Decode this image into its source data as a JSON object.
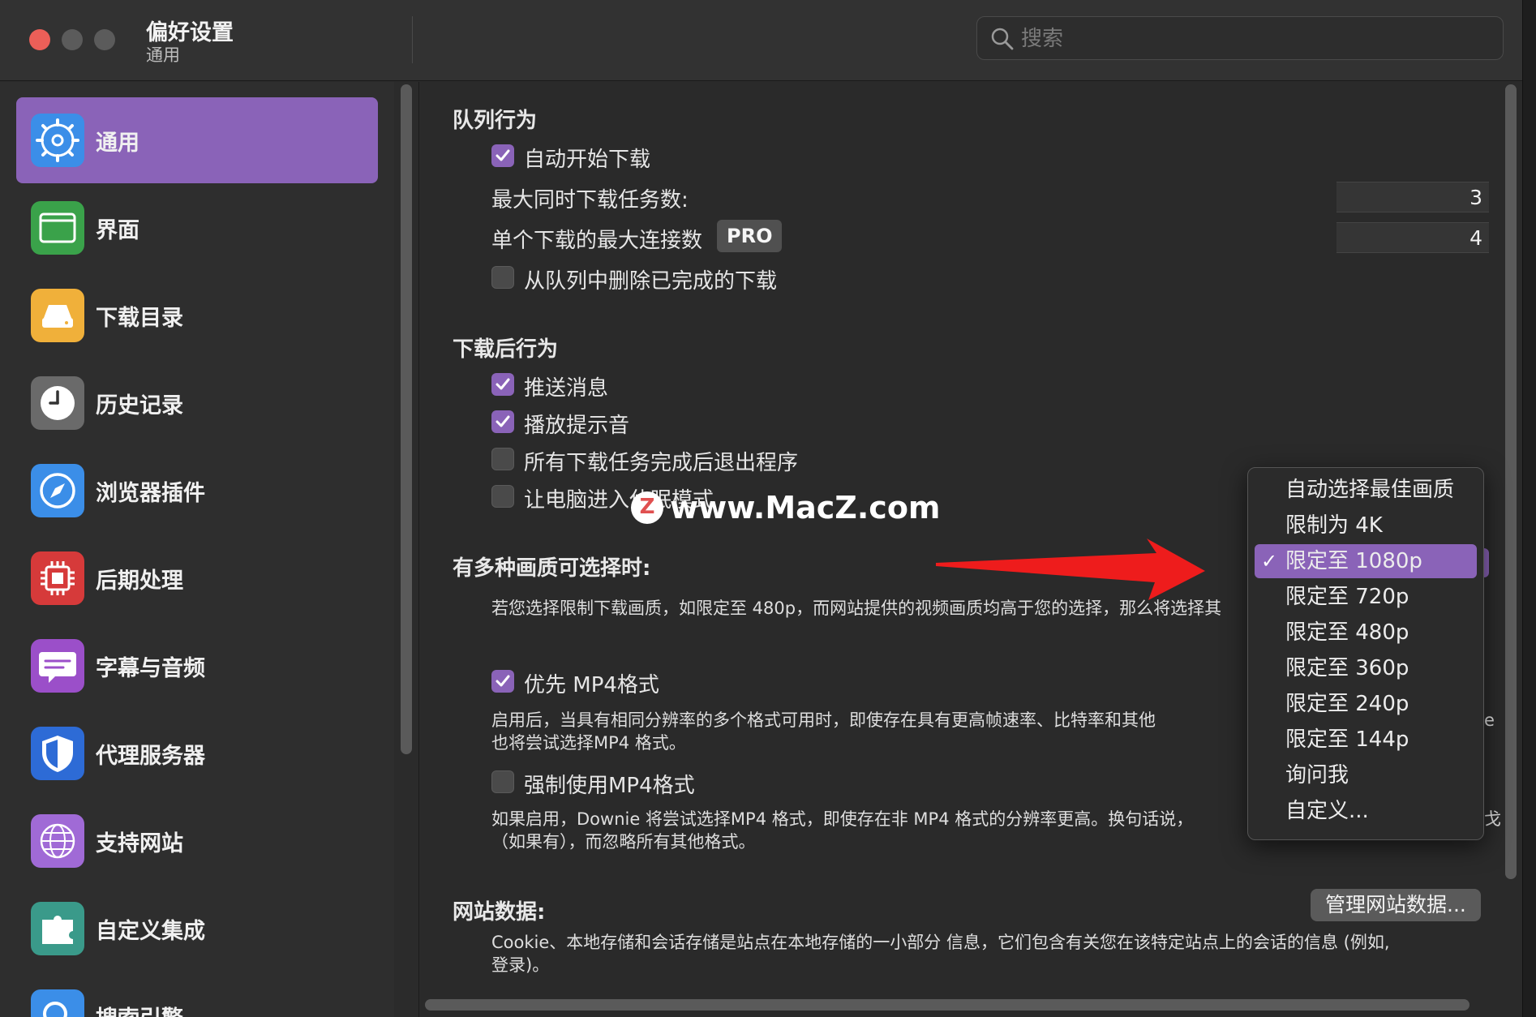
{
  "window": {
    "title": "偏好设置",
    "subtitle": "通用",
    "search_placeholder": "搜索"
  },
  "sidebar": {
    "items": [
      {
        "label": "通用",
        "icon": "gear-icon",
        "color": "#3b8ee8",
        "active": true
      },
      {
        "label": "界面",
        "icon": "window-icon",
        "color": "#3aa24a"
      },
      {
        "label": "下载目录",
        "icon": "drive-icon",
        "color": "#f0b03a"
      },
      {
        "label": "历史记录",
        "icon": "clock-icon",
        "color": "#6a6a6a"
      },
      {
        "label": "浏览器插件",
        "icon": "compass-icon",
        "color": "#3b8ee8"
      },
      {
        "label": "后期处理",
        "icon": "chip-icon",
        "color": "#d63a3a"
      },
      {
        "label": "字幕与音频",
        "icon": "caption-icon",
        "color": "#9b4fc9"
      },
      {
        "label": "代理服务器",
        "icon": "shield-icon",
        "color": "#2d6bd6"
      },
      {
        "label": "支持网站",
        "icon": "globe-icon",
        "color": "#a06ad6"
      },
      {
        "label": "自定义集成",
        "icon": "puzzle-icon",
        "color": "#3a9a8a"
      },
      {
        "label": "搜索引擎",
        "icon": "search-engine-icon",
        "color": "#3b8ee8"
      }
    ]
  },
  "queue": {
    "title": "队列行为",
    "auto_start": {
      "label": "自动开始下载",
      "checked": true
    },
    "max_tasks": {
      "label": "最大同时下载任务数:",
      "value": "3"
    },
    "max_connections": {
      "label": "单个下载的最大连接数",
      "badge": "PRO",
      "value": "4"
    },
    "remove_done": {
      "label": "从队列中删除已完成的下载",
      "checked": false
    }
  },
  "after": {
    "title": "下载后行为",
    "push": {
      "label": "推送消息",
      "checked": true
    },
    "sound": {
      "label": "播放提示音",
      "checked": true
    },
    "quit": {
      "label": "所有下载任务完成后退出程序",
      "checked": false
    },
    "sleep": {
      "label": "让电脑进入休眠模式",
      "checked": false
    }
  },
  "quality": {
    "title": "有多种画质可选择时:",
    "desc": "若您选择限制下载画质，如限定至 480p，而网站提供的视频画质均高于您的选择，那么将选择其",
    "prefer_mp4": {
      "label": "优先 MP4格式",
      "checked": true
    },
    "prefer_desc_1": "启用后，当具有相同分辨率的多个格式可用时，即使存在具有更高帧速率、比特率和其他",
    "prefer_desc_2": "也将尝试选择MP4 格式。",
    "prefer_tail": "e",
    "force_mp4": {
      "label": "强制使用MP4格式",
      "checked": false
    },
    "force_desc_1": "如果启用，Downie 将尝试选择MP4 格式，即使存在非 MP4 格式的分辨率更高。换句话说，",
    "force_desc_2": "（如果有），而忽略所有其他格式。",
    "force_tail": "戈"
  },
  "website_data": {
    "title": "网站数据:",
    "button": "管理网站数据...",
    "desc_1": "Cookie、本地存储和会话存储是站点在本地存储的一小部分 信息，它们包含有关您在该特定站点上的会话的信息 (例如,",
    "desc_2": "登录)。"
  },
  "dropdown": {
    "options": [
      "自动选择最佳画质",
      "限制为 4K",
      "限定至 1080p",
      "限定至 720p",
      "限定至 480p",
      "限定至 360p",
      "限定至 240p",
      "限定至 144p",
      "询问我",
      "自定义..."
    ],
    "selected_index": 2,
    "check": "✓"
  },
  "watermark": {
    "text": "www.MacZ.com",
    "logo": "Z"
  },
  "colors": {
    "accent": "#8a63b8",
    "arrow": "#ee1c1c"
  }
}
